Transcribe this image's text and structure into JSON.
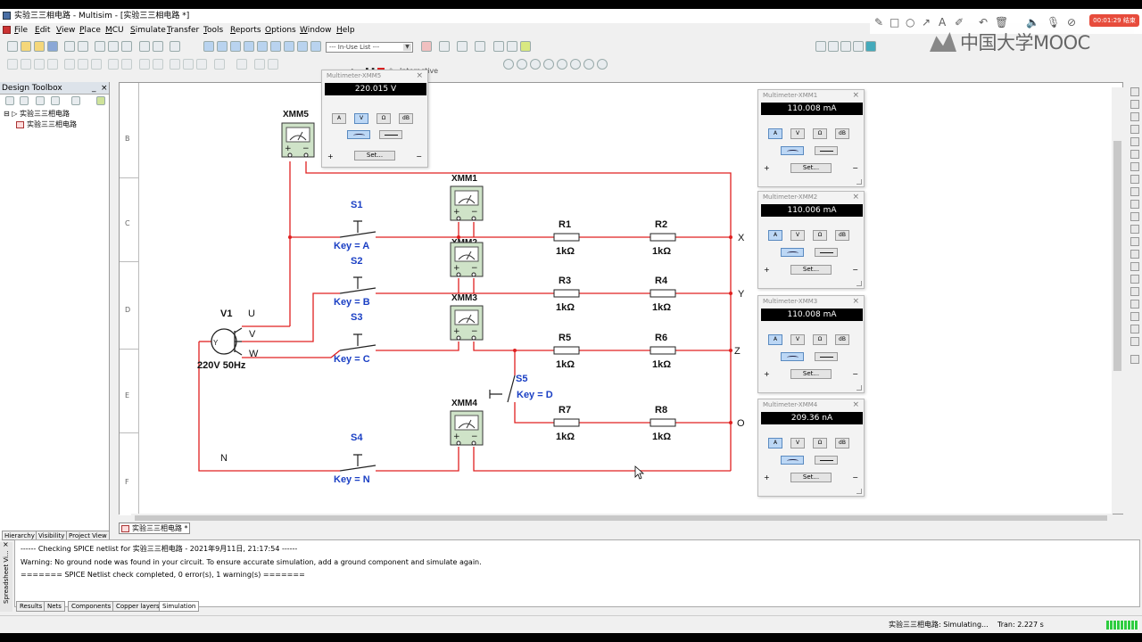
{
  "window": {
    "title": "实验三三相电路 - Multisim - [实验三三相电路 *]"
  },
  "menu": [
    {
      "label": "File",
      "u": "F",
      "rest": "ile"
    },
    {
      "label": "Edit",
      "u": "E",
      "rest": "dit"
    },
    {
      "label": "View",
      "u": "V",
      "rest": "iew"
    },
    {
      "label": "Place",
      "u": "P",
      "rest": "lace"
    },
    {
      "label": "MCU",
      "u": "M",
      "rest": "CU"
    },
    {
      "label": "Simulate",
      "u": "S",
      "rest": "imulate"
    },
    {
      "label": "Transfer",
      "u": "T",
      "rest": "ransfer"
    },
    {
      "label": "Tools",
      "u": "T",
      "rest": "ools"
    },
    {
      "label": "Reports",
      "u": "R",
      "rest": "eports"
    },
    {
      "label": "Options",
      "u": "O",
      "rest": "ptions"
    },
    {
      "label": "Window",
      "u": "W",
      "rest": "indow"
    },
    {
      "label": "Help",
      "u": "H",
      "rest": "elp"
    }
  ],
  "toolbar": {
    "in_use_list": "--- In-Use List ---",
    "interactive": "Interactive"
  },
  "recording": {
    "badge": "00:01:29 结束"
  },
  "watermark": {
    "text": "中国大学MOOC"
  },
  "design_toolbox": {
    "title": "Design Toolbox",
    "root": "实验三三相电路",
    "child": "实验三三相电路"
  },
  "left_tabs": [
    "Hierarchy",
    "Visibility",
    "Project View"
  ],
  "ruler_rows": [
    "B",
    "C",
    "D",
    "E",
    "F"
  ],
  "sheet_tab": "实验三三相电路 *",
  "schematic": {
    "source": {
      "name": "V1",
      "value": "220V 50Hz",
      "symbol": "Y",
      "phases": [
        "U",
        "V",
        "W"
      ]
    },
    "neutral_label": "N",
    "terminals": [
      "X",
      "Y",
      "Z",
      "O"
    ],
    "switches": [
      {
        "name": "S1",
        "key": "Key = A"
      },
      {
        "name": "S2",
        "key": "Key = B"
      },
      {
        "name": "S3",
        "key": "Key = C"
      },
      {
        "name": "S4",
        "key": "Key = N"
      },
      {
        "name": "S5",
        "key": "Key = D"
      }
    ],
    "resistors": [
      {
        "name": "R1",
        "value": "1kΩ"
      },
      {
        "name": "R2",
        "value": "1kΩ"
      },
      {
        "name": "R3",
        "value": "1kΩ"
      },
      {
        "name": "R4",
        "value": "1kΩ"
      },
      {
        "name": "R5",
        "value": "1kΩ"
      },
      {
        "name": "R6",
        "value": "1kΩ"
      },
      {
        "name": "R7",
        "value": "1kΩ"
      },
      {
        "name": "R8",
        "value": "1kΩ"
      }
    ],
    "meters": [
      "XMM5",
      "XMM1",
      "XMM2",
      "XMM3",
      "XMM4"
    ]
  },
  "multimeters": [
    {
      "title": "Multimeter-XMM5",
      "reading": "220.015 V",
      "mode": "V"
    },
    {
      "title": "Multimeter-XMM1",
      "reading": "110.008 mA",
      "mode": "A"
    },
    {
      "title": "Multimeter-XMM2",
      "reading": "110.006 mA",
      "mode": "A"
    },
    {
      "title": "Multimeter-XMM3",
      "reading": "110.008 mA",
      "mode": "A"
    },
    {
      "title": "Multimeter-XMM4",
      "reading": "209.36 nA",
      "mode": "A"
    }
  ],
  "mm_buttons": [
    "A",
    "V",
    "Ω",
    "dB"
  ],
  "mm_set": "Set...",
  "output": {
    "lines": [
      "------ Checking SPICE netlist for 实验三三相电路 - 2021年9月11日, 21:17:54 ------",
      "Warning: No ground node was found in your circuit. To ensure accurate simulation, add a ground component and simulate again.",
      "======= SPICE Netlist check completed, 0 error(s), 1 warning(s) ======="
    ],
    "side_label": "Spreadsheet Vi...",
    "tabs": [
      "Results",
      "Nets",
      "Components",
      "Copper layers",
      "Simulation"
    ]
  },
  "status": {
    "sim": "实验三三相电路: Simulating...",
    "tran": "Tran: 2.227 s"
  },
  "colors": {
    "wire": "#e02020",
    "label_blue": "#1a3fc4",
    "meter_fill": "#cfe3c8"
  }
}
